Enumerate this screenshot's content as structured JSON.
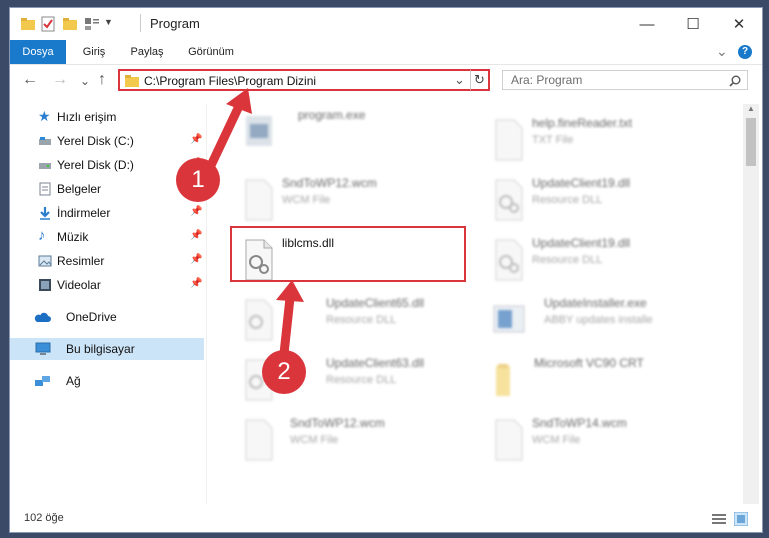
{
  "window": {
    "title": "Program",
    "controls": {
      "minimize": "—",
      "maximize": "☐",
      "close": "✕"
    }
  },
  "ribbon": {
    "tabs": [
      {
        "label": "Dosya",
        "active": true
      },
      {
        "label": "Giriş"
      },
      {
        "label": "Paylaş"
      },
      {
        "label": "Görünüm"
      }
    ],
    "expand_glyph": "⌄",
    "help_glyph": "?"
  },
  "navbar": {
    "back": "←",
    "forward": "→",
    "recent": "⌄",
    "up": "↑",
    "address": "C:\\Program Files\\Program Dizini",
    "refresh": "↻",
    "dropdown": "⌄",
    "search_placeholder": "Ara: Program"
  },
  "sidebar": {
    "items": [
      {
        "label": "Hızlı erişim",
        "icon": "star-icon",
        "pinned": false
      },
      {
        "label": "Yerel Disk (C:)",
        "icon": "drive-icon",
        "pinned": true
      },
      {
        "label": "Yerel Disk (D:)",
        "icon": "drive-icon",
        "pinned": true
      },
      {
        "label": "Belgeler",
        "icon": "document-icon",
        "pinned": true
      },
      {
        "label": "İndirmeler",
        "icon": "download-icon",
        "pinned": true
      },
      {
        "label": "Müzik",
        "icon": "music-icon",
        "pinned": true
      },
      {
        "label": "Resimler",
        "icon": "pictures-icon",
        "pinned": true
      },
      {
        "label": "Videolar",
        "icon": "video-icon",
        "pinned": true
      },
      {
        "label": "OneDrive",
        "icon": "cloud-icon",
        "pinned": false
      },
      {
        "label": "Bu bilgisayar",
        "icon": "computer-icon",
        "pinned": false,
        "selected": true
      },
      {
        "label": "Ağ",
        "icon": "network-icon",
        "pinned": false
      }
    ]
  },
  "files": [
    {
      "name": "program.exe",
      "type": "",
      "icon": "exe-icon"
    },
    {
      "name": "help.fineReader.txt",
      "type": "TXT File",
      "icon": "text-file-icon"
    },
    {
      "name": "SndToWP12.wcm",
      "type": "WCM File",
      "icon": "file-icon"
    },
    {
      "name": "UpdateClient19.dll",
      "type": "Resource DLL",
      "icon": "dll-icon"
    },
    {
      "name": "liblcms.dll",
      "type": "",
      "icon": "dll-icon"
    },
    {
      "name": "UpdateClient19.dll",
      "type": "Resource DLL",
      "icon": "dll-icon"
    },
    {
      "name": "UpdateClient65.dll",
      "type": "Resource DLL",
      "icon": "dll-icon"
    },
    {
      "name": "UpdateInstaller.exe",
      "type": "ABBY updates installe",
      "icon": "installer-icon"
    },
    {
      "name": "UpdateClient63.dll",
      "type": "Resource DLL",
      "icon": "dll-icon"
    },
    {
      "name": "Microsoft VC90 CRT",
      "type": "",
      "icon": "folder-icon"
    },
    {
      "name": "SndToWP12.wcm",
      "type": "WCM File",
      "icon": "file-icon"
    },
    {
      "name": "SndToWP14.wcm",
      "type": "WCM File",
      "icon": "file-icon"
    }
  ],
  "status": {
    "count": "102 öğe"
  },
  "annotations": {
    "step1": "1",
    "step2": "2"
  },
  "colors": {
    "accent": "#1979ca",
    "highlight": "#d9353b",
    "selected": "#cce4f7"
  }
}
